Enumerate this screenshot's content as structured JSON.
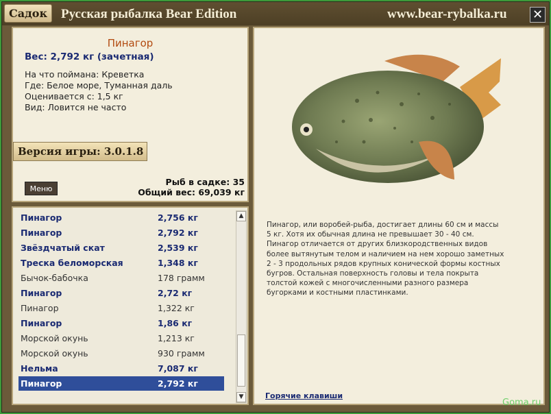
{
  "titlebar": {
    "sadok_label": "Садок",
    "title": "Русская рыбалка Bear Edition",
    "url": "www.bear-rybalka.ru",
    "close_glyph": "✕"
  },
  "catch": {
    "name": "Пинагор",
    "weight": "Вес: 2,792 кг (зачетная)",
    "bait": "На что поймана: Креветка",
    "place": "Где: Белое море, Туманная даль",
    "value": "Оценивается с: 1,5 кг",
    "kind": "Вид: Ловится не часто"
  },
  "version": "Версия игры: 3.0.1.8",
  "menu_label": "Меню",
  "stats": {
    "count": "Рыб в садке: 35",
    "total": "Общий вес: 69,039 кг"
  },
  "list": [
    {
      "name": "Пинагор",
      "weight": "2,756 кг",
      "style": "b"
    },
    {
      "name": "Пинагор",
      "weight": "2,792 кг",
      "style": "b"
    },
    {
      "name": "Звёздчатый скат",
      "weight": "2,539 кг",
      "style": "b"
    },
    {
      "name": "Треска беломорская",
      "weight": "1,348 кг",
      "style": "b"
    },
    {
      "name": "Бычок-бабочка",
      "weight": "178 грамм",
      "style": "p"
    },
    {
      "name": "Пинагор",
      "weight": "2,72 кг",
      "style": "b"
    },
    {
      "name": "Пинагор",
      "weight": "1,322 кг",
      "style": "p"
    },
    {
      "name": "Пинагор",
      "weight": "1,86 кг",
      "style": "b"
    },
    {
      "name": "Морской окунь",
      "weight": "1,213 кг",
      "style": "p"
    },
    {
      "name": "Морской окунь",
      "weight": "930 грамм",
      "style": "p"
    },
    {
      "name": "Нельма",
      "weight": "7,087 кг",
      "style": "b"
    },
    {
      "name": "Пинагор",
      "weight": "2,792 кг",
      "style": "sel"
    }
  ],
  "description": "Пинагор, или воробей-рыба, достигает длины 60 см и массы 5 кг. Хотя их обычная длина не превышает 30 - 40 см. Пинагор отличается от других близкородственных видов более вытянутым телом и наличием на нем хорошо заметных 2 - 3 продольных рядов крупных конической формы костных бугров. Остальная поверхность головы и тела покрыта толстой кожей с многочисленными разного размера бугорками и костными пластинками.",
  "hotkeys": "Горячие клавиши",
  "watermark": "Goma.ru",
  "icons": {
    "close": "close-icon",
    "up": "arrow-up-icon",
    "down": "arrow-down-icon",
    "fish": "fish-picture"
  }
}
